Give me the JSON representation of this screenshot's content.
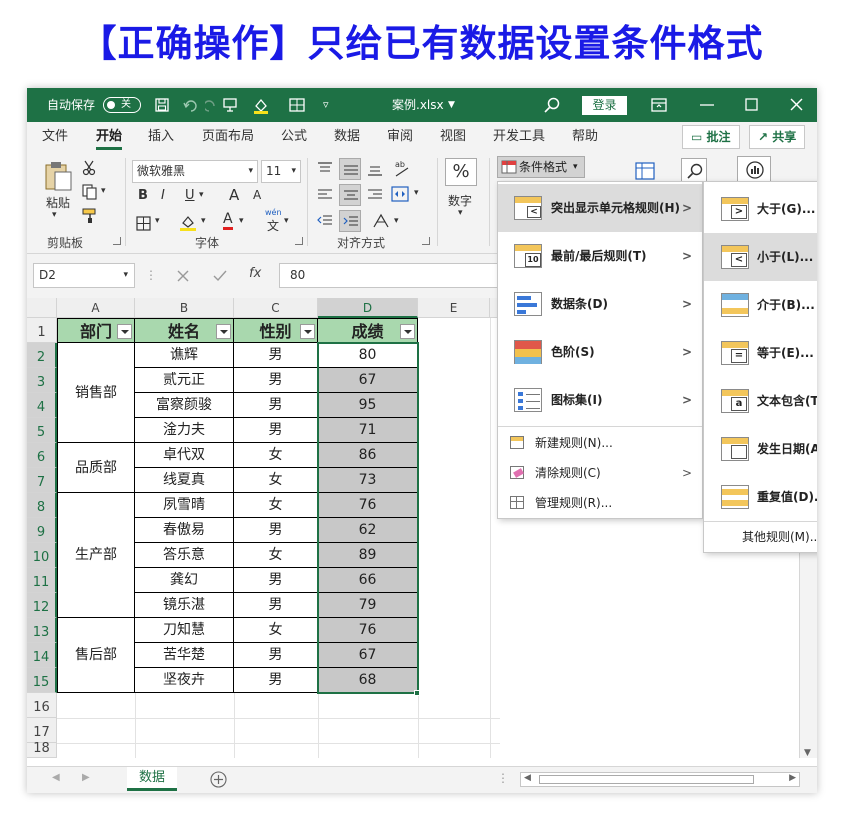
{
  "page_title": "【正确操作】只给已有数据设置条件格式",
  "titlebar": {
    "autosave_label": "自动保存",
    "autosave_state": "关",
    "filename": "案例.xlsx",
    "login_label": "登录"
  },
  "tabs": [
    "文件",
    "开始",
    "插入",
    "页面布局",
    "公式",
    "数据",
    "审阅",
    "视图",
    "开发工具",
    "帮助"
  ],
  "tab_buttons": {
    "comment": "批注",
    "share": "共享"
  },
  "ribbon": {
    "paste_label": "粘贴",
    "clipboard_label": "剪贴板",
    "font_name": "微软雅黑",
    "font_size": "11",
    "font_label": "字体",
    "align_label": "对齐方式",
    "number_label": "数字",
    "number_symbol": "%",
    "bold": "B",
    "italic": "I",
    "underline": "U",
    "grow_font": "A",
    "shrink_font": "A",
    "font_color": "A",
    "wen": "wén",
    "wen_char": "文",
    "cond_format_label": "条件格式"
  },
  "formula_bar": {
    "name_box": "D2",
    "fx": "fx",
    "value": "80"
  },
  "columns": [
    "A",
    "B",
    "C",
    "D",
    "E"
  ],
  "rows": [
    "1",
    "2",
    "3",
    "4",
    "5",
    "6",
    "7",
    "8",
    "9",
    "10",
    "11",
    "12",
    "13",
    "14",
    "15",
    "16",
    "17",
    "18"
  ],
  "table": {
    "headers": [
      "部门",
      "姓名",
      "性别",
      "成绩"
    ],
    "departments": [
      "销售部",
      "品质部",
      "生产部",
      "售后部"
    ],
    "names": [
      "谯辉",
      "贰元正",
      "富察颜骏",
      "淦力夫",
      "卓代双",
      "线夏真",
      "夙雪晴",
      "春傲易",
      "答乐意",
      "龚幻",
      "镜乐湛",
      "刀知慧",
      "苦华楚",
      "坚夜卉"
    ],
    "genders": [
      "男",
      "男",
      "男",
      "男",
      "女",
      "女",
      "女",
      "男",
      "女",
      "男",
      "男",
      "女",
      "男",
      "男"
    ],
    "scores": [
      "80",
      "67",
      "95",
      "71",
      "86",
      "73",
      "76",
      "62",
      "89",
      "66",
      "79",
      "76",
      "67",
      "68"
    ]
  },
  "sheet_tab": "数据",
  "menu": {
    "items": [
      {
        "label": "突出显示单元格规则(H)"
      },
      {
        "label": "最前/最后规则(T)"
      },
      {
        "label": "数据条(D)"
      },
      {
        "label": "色阶(S)"
      },
      {
        "label": "图标集(I)"
      }
    ],
    "small_items": [
      {
        "label": "新建规则(N)..."
      },
      {
        "label": "清除规则(C)"
      },
      {
        "label": "管理规则(R)..."
      }
    ],
    "icon_number": "10"
  },
  "submenu": {
    "items": [
      {
        "label": "大于(G)...",
        "sym": ">"
      },
      {
        "label": "小于(L)...",
        "sym": "<"
      },
      {
        "label": "介于(B)...",
        "sym": ""
      },
      {
        "label": "等于(E)...",
        "sym": "="
      },
      {
        "label": "文本包含(T",
        "sym": "a"
      },
      {
        "label": "发生日期(A",
        "sym": ""
      },
      {
        "label": "重复值(D)...",
        "sym": ""
      }
    ],
    "more": "其他规则(M)..."
  },
  "colors": {
    "title_blue": "#1a1ae6",
    "excel_green": "#1e7145",
    "header_green": "#a9d8ae",
    "selection_grey": "#c8c8c8"
  }
}
